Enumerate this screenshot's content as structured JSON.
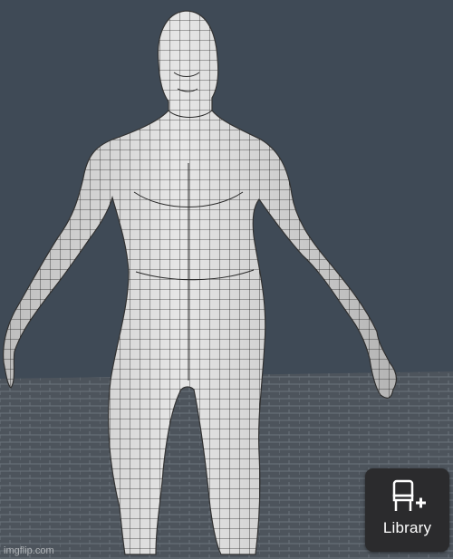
{
  "viewport": {
    "background_color": "#3f4a56",
    "floor_color": "#4d545c",
    "floor_line_color": "#6b737c",
    "model_color": "#e6e6e6",
    "wire_color": "#2a2a2a"
  },
  "library_button": {
    "label": "Library",
    "icon": "chair-plus-icon",
    "background_color": "#2b2b2d"
  },
  "watermark": {
    "text": "imgflip.com"
  }
}
